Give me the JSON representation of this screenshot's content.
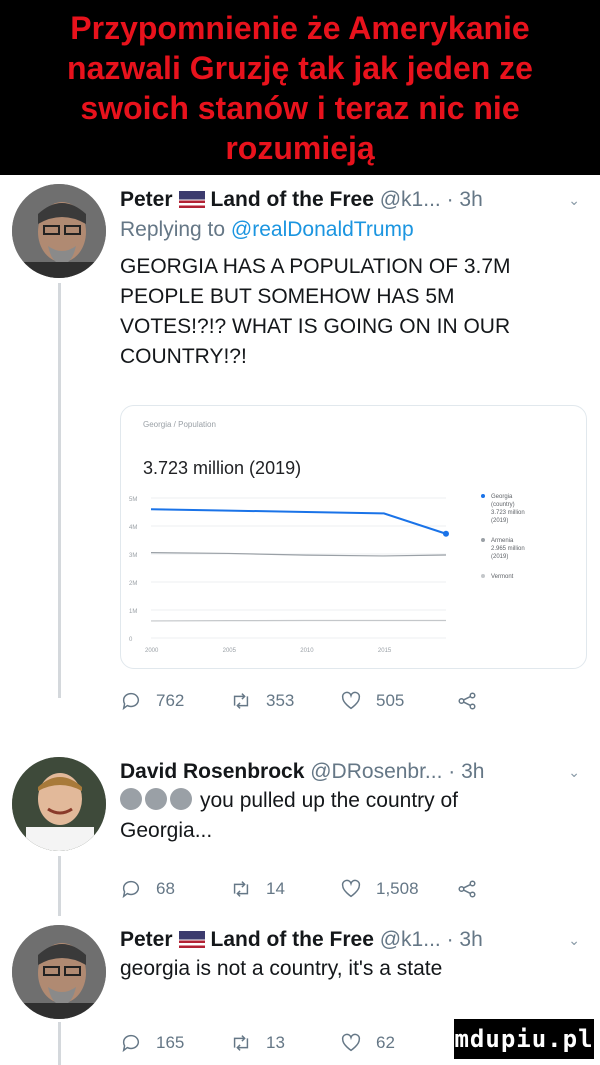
{
  "banner": {
    "lines": [
      "Przypomnienie że Amerykanie",
      "nazwali Gruzję tak jak jeden ze",
      "swoich stanów i teraz nic nie",
      "rozumieją"
    ]
  },
  "tweets": [
    {
      "name": "Peter",
      "flag_icon": "us-flag-icon",
      "display_suffix": "Land of the Free",
      "handle": "@k1...",
      "time": "· 3h",
      "reply_prefix": "Replying to",
      "reply_handle": "@realDonaldTrump",
      "text_lines": [
        "GEORGIA HAS A POPULATION OF 3.7M",
        "PEOPLE BUT SOMEHOW HAS 5M",
        "VOTES!?!? WHAT IS GOING ON IN OUR",
        "COUNTRY!?!"
      ],
      "counts": {
        "replies": "762",
        "retweets": "353",
        "likes": "505"
      }
    },
    {
      "name": "David Rosenbrock",
      "handle": "@DRosenbr...",
      "time": "· 3h",
      "emoji_icons": [
        "laughing-emoji-icon",
        "laughing-emoji-icon",
        "laughing-emoji-icon"
      ],
      "text_lines": [
        "you pulled up the country of",
        "Georgia..."
      ],
      "counts": {
        "replies": "68",
        "retweets": "14",
        "likes": "1,508"
      }
    },
    {
      "name": "Peter",
      "flag_icon": "us-flag-icon",
      "display_suffix": "Land of the Free",
      "handle": "@k1...",
      "time": "· 3h",
      "text_lines": [
        "georgia is not a country, it's a state"
      ],
      "counts": {
        "replies": "165",
        "retweets": "13",
        "likes": "62"
      }
    }
  ],
  "card": {
    "breadcrumb": "Georgia / Population",
    "headline": "3.723 million (2019)",
    "chart_data": {
      "type": "line",
      "x": [
        2000,
        2005,
        2010,
        2015,
        2019
      ],
      "xticks": [
        "2000",
        "2005",
        "2010",
        "2015"
      ],
      "yticks": [
        "5M",
        "4M",
        "3M",
        "2M",
        "1M",
        "0"
      ],
      "ylim": [
        0,
        5
      ],
      "series": [
        {
          "name": "Georgia (country)",
          "legend": [
            "Georgia",
            "(country)",
            "3.723 million",
            "(2019)"
          ],
          "color": "#1a73e8",
          "values": [
            4.6,
            4.55,
            4.5,
            4.45,
            3.723
          ]
        },
        {
          "name": "Armenia",
          "legend": [
            "Armenia",
            "2.965 million",
            "(2019)"
          ],
          "color": "#9aa0a6",
          "values": [
            3.05,
            3.02,
            2.96,
            2.93,
            2.965
          ]
        },
        {
          "name": "Vermont",
          "legend": [
            "Vermont"
          ],
          "color": "#c4c7ca",
          "values": [
            0.61,
            0.62,
            0.625,
            0.626,
            0.624
          ]
        }
      ]
    }
  },
  "watermark": {
    "text": "mdupiu.pl"
  },
  "colors": {
    "banner_text": "#e8121c",
    "link": "#1b95e0",
    "secondary": "#657786"
  }
}
